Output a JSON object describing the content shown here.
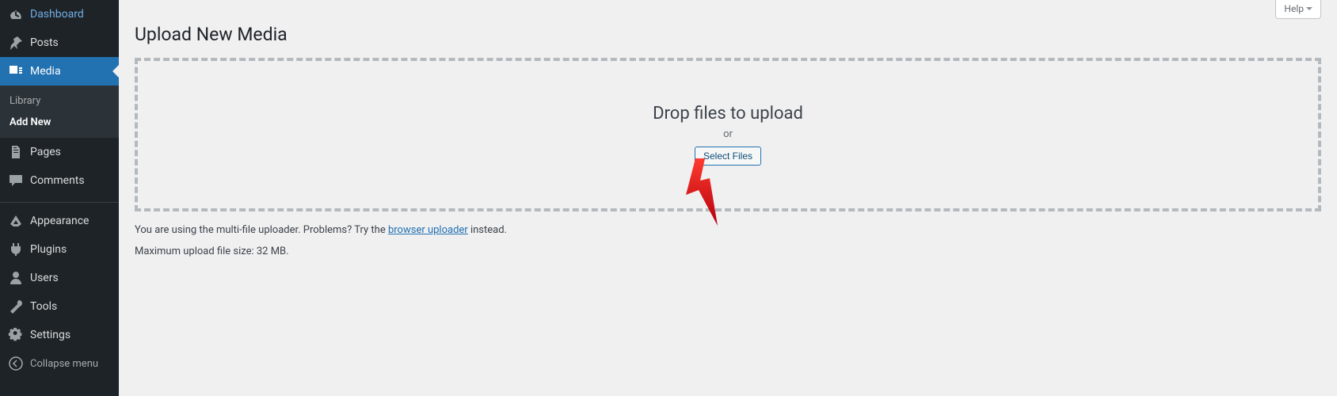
{
  "help_label": "Help",
  "page_title": "Upload New Media",
  "drop": {
    "title": "Drop files to upload",
    "or": "or",
    "select_button": "Select Files"
  },
  "hint": {
    "prefix": "You are using the multi-file uploader. Problems? Try the ",
    "link": "browser uploader",
    "suffix": " instead."
  },
  "max_upload": "Maximum upload file size: 32 MB.",
  "sidebar": {
    "items": [
      {
        "label": "Dashboard",
        "icon": "dashboard"
      },
      {
        "label": "Posts",
        "icon": "posts"
      },
      {
        "label": "Media",
        "icon": "media",
        "active": true
      },
      {
        "label": "Pages",
        "icon": "pages"
      },
      {
        "label": "Comments",
        "icon": "comments"
      },
      {
        "label": "Appearance",
        "icon": "appearance"
      },
      {
        "label": "Plugins",
        "icon": "plugins"
      },
      {
        "label": "Users",
        "icon": "users"
      },
      {
        "label": "Tools",
        "icon": "tools"
      },
      {
        "label": "Settings",
        "icon": "settings"
      }
    ],
    "submenu": [
      {
        "label": "Library"
      },
      {
        "label": "Add New",
        "current": true
      }
    ],
    "collapse": "Collapse menu"
  }
}
